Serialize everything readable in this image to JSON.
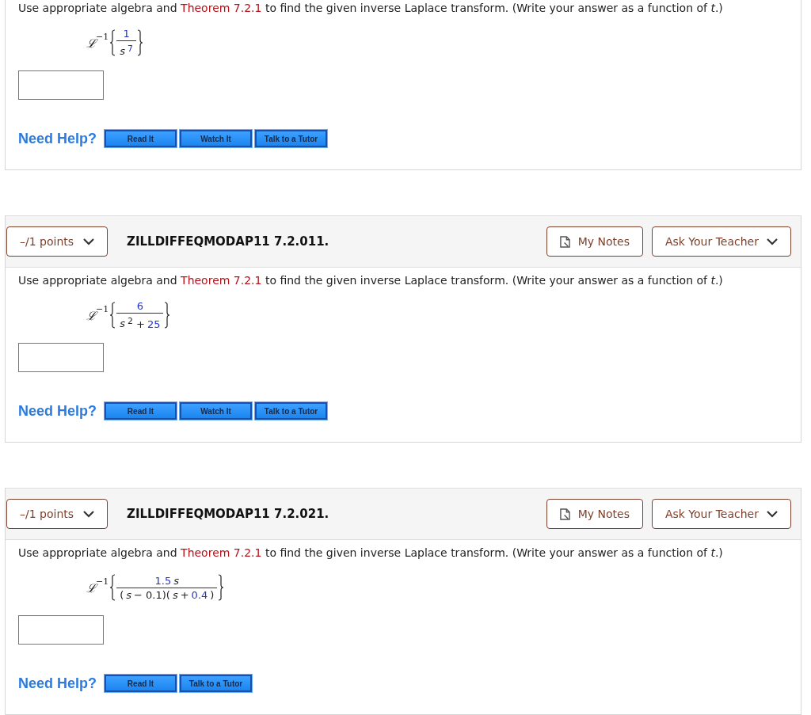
{
  "problems": [
    {
      "prompt": {
        "before": "Use appropriate algebra and",
        "link": "Theorem 7.2.1",
        "after": "to find the given inverse Laplace transform. (Write your answer as a function of *t*.)"
      },
      "expression": {
        "operator": "ℒ",
        "exponent": "−1",
        "numerator": [
          {
            "text": "1",
            "kind": "num"
          }
        ],
        "denominator": [
          {
            "text": "s",
            "kind": "var"
          },
          {
            "text": "$^{7}$",
            "kind": "num"
          }
        ]
      },
      "help": {
        "label": "Need Help?",
        "buttons": [
          "Read It",
          "Watch It",
          "Talk to a Tutor"
        ]
      }
    },
    {
      "header": {
        "points": "–/1 points",
        "code": "ZILLDIFFEQMODAP11 7.2.011.",
        "notes": "My Notes",
        "ask": "Ask Your Teacher"
      },
      "prompt": {
        "before": "Use appropriate algebra and",
        "link": "Theorem 7.2.1",
        "after": "to find the given inverse Laplace transform. (Write your answer as a function of *t*.)"
      },
      "expression": {
        "operator": "ℒ",
        "exponent": "−1",
        "numerator": [
          {
            "text": "6",
            "kind": "num"
          }
        ],
        "denominator": [
          {
            "text": "s",
            "kind": "var"
          },
          {
            "text": "$^{2}$ +",
            "kind": "op"
          },
          {
            "text": "25",
            "kind": "num"
          }
        ]
      },
      "help": {
        "label": "Need Help?",
        "buttons": [
          "Read It",
          "Watch It",
          "Talk to a Tutor"
        ]
      }
    },
    {
      "header": {
        "points": "–/1 points",
        "code": "ZILLDIFFEQMODAP11 7.2.021.",
        "notes": "My Notes",
        "ask": "Ask Your Teacher"
      },
      "prompt": {
        "before": "Use appropriate algebra and",
        "link": "Theorem 7.2.1",
        "after": "to find the given inverse Laplace transform. (Write your answer as a function of *t*.)"
      },
      "expression": {
        "operator": "ℒ",
        "exponent": "−1",
        "numerator": [
          {
            "text": "1.5",
            "kind": "num"
          },
          {
            "text": "s",
            "kind": "var"
          }
        ],
        "denominator": [
          {
            "text": "(",
            "kind": "op"
          },
          {
            "text": "s",
            "kind": "var"
          },
          {
            "text": "− 0.1)(",
            "kind": "op"
          },
          {
            "text": "s",
            "kind": "var"
          },
          {
            "text": "+",
            "kind": "op"
          },
          {
            "text": "0.4",
            "kind": "num"
          },
          {
            "text": ")",
            "kind": "op"
          }
        ]
      },
      "help": {
        "label": "Need Help?",
        "buttons": [
          "Read It",
          "Talk to a Tutor"
        ]
      }
    }
  ]
}
